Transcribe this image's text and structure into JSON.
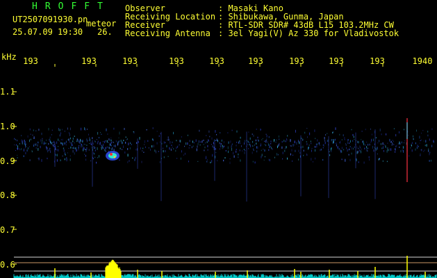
{
  "header": {
    "brand": "HROFFT",
    "filename": "UT2507091930.pn",
    "meteor_label": "meteor",
    "datetime": "25.07.09 19:30",
    "counter": "26.",
    "fields": [
      {
        "label": "Observer",
        "value": ": Masaki Kano"
      },
      {
        "label": "Receiving Location",
        "value": ": Shibukawa, Gunma, Japan"
      },
      {
        "label": "Receiver",
        "value": ": RTL-SDR SDR# 43dB L15 103.2MHz CW"
      },
      {
        "label": "Receiving Antenna",
        "value": ": 3el Yagi(V) Az 330 for Vladivostok"
      }
    ]
  },
  "axis": {
    "unit": "kHz",
    "x_ticks": [
      "193",
      "193",
      "193",
      "193",
      "193",
      "193",
      "193",
      "193",
      "193",
      "1940"
    ],
    "y_ticks": [
      "1.1",
      "1.0",
      "0.9",
      "0.8",
      "0.7",
      "0.6"
    ]
  },
  "colors": {
    "text": "#ffff33",
    "brand": "#33ff33",
    "background": "#000000",
    "baseline": "#00c8c8",
    "spike": "#ffff00"
  }
}
